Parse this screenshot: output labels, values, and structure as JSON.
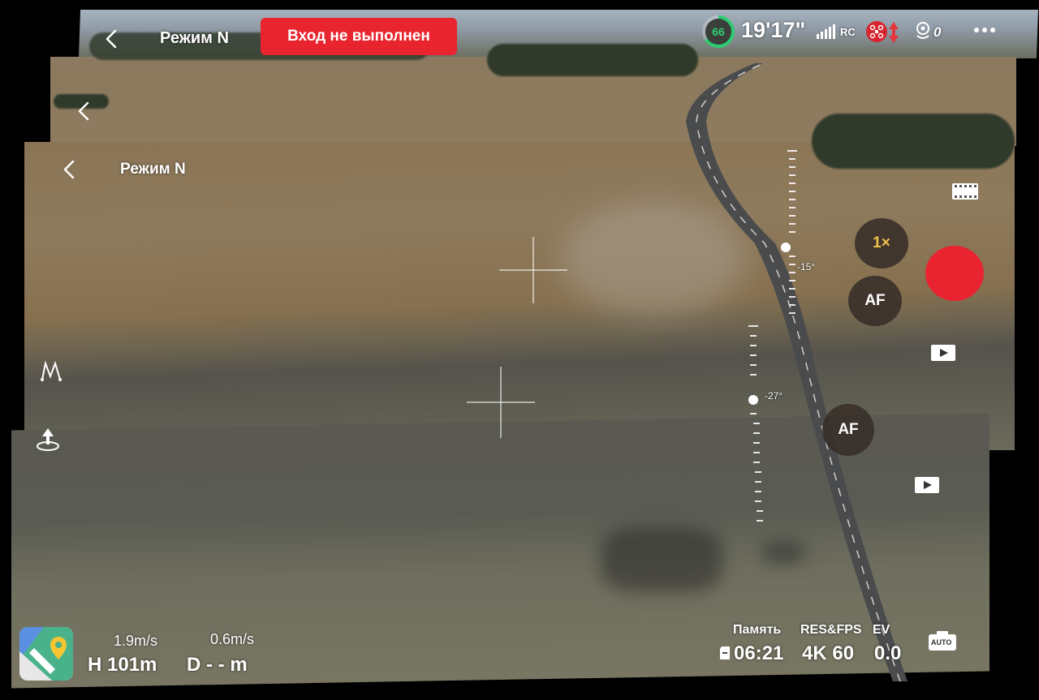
{
  "screens": [
    {
      "mode_label": "Режим N"
    },
    {
      "mode_label": ""
    },
    {
      "mode_label": "Режим N"
    }
  ],
  "header": {
    "alert_text": "Вход не выполнен",
    "battery_percent": "66",
    "flight_time": "19'17\"",
    "rc_label": "RC",
    "vision_count": "0"
  },
  "camera": {
    "zoom_label": "1×",
    "af_label_1": "AF",
    "af_label_2": "AF",
    "gimbal_angle_1": "-15°",
    "gimbal_angle_2": "-27°",
    "auto_label": "AUTO"
  },
  "telemetry": {
    "vertical_speed": "1.9m/s",
    "horizontal_speed": "0.6m/s",
    "height": "H 101m",
    "distance": "D - - m"
  },
  "storage": {
    "memory_label": "Память",
    "memory_value": "06:21",
    "res_label": "RES&FPS",
    "res_value": "4K 60",
    "ev_label": "EV",
    "ev_value": "0.0"
  },
  "colors": {
    "alert_red": "#e8252e",
    "record_red": "#ea2330",
    "battery_green": "#2ecc71",
    "zoom_yellow": "#f1c24a"
  }
}
